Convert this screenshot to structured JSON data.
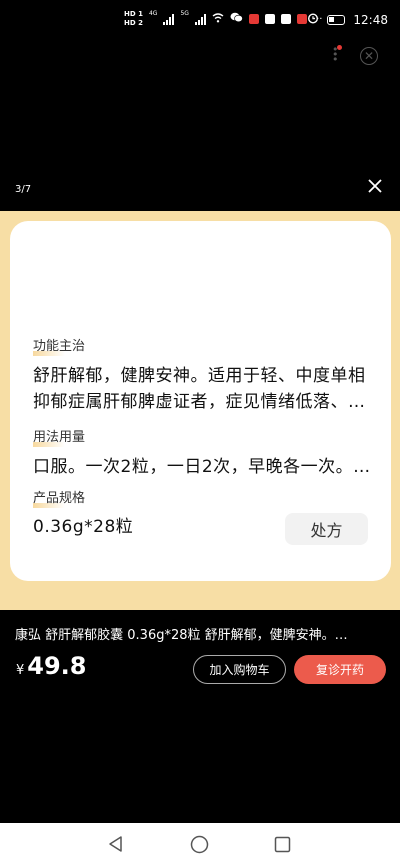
{
  "status_bar": {
    "hd1": "HD 1",
    "hd2": "HD 2",
    "net1": "4G",
    "net2": "5G",
    "time": "12:48"
  },
  "viewer": {
    "counter": "3/7"
  },
  "card": {
    "function_label": "功能主治",
    "function_line1": "舒肝解郁，健脾安神。适用于轻、中度单相",
    "function_line2": "抑郁症属肝郁脾虚证者，症见情绪低落、…",
    "usage_label": "用法用量",
    "usage_text": "口服。一次2粒，一日2次，早晚各一次。…",
    "spec_label": "产品规格",
    "spec_value": "0.36g*28粒",
    "rx_label": "处方"
  },
  "product": {
    "title": "康弘 舒肝解郁胶囊 0.36g*28粒 舒肝解郁，健脾安神。…",
    "currency": "¥",
    "price": "49.8",
    "add_cart_label": "加入购物车",
    "buy_label": "复诊开药"
  },
  "colors": {
    "band": "#f7dea5",
    "accent_red": "#ec5b4c"
  }
}
